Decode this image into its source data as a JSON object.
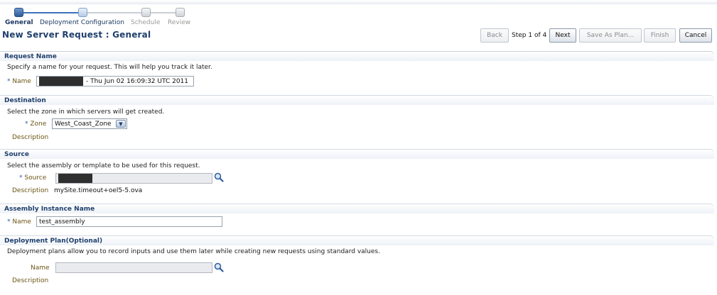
{
  "train": {
    "steps": [
      {
        "label": "General",
        "state": "active"
      },
      {
        "label": "Deployment Configuration",
        "state": "next"
      },
      {
        "label": "Schedule",
        "state": "disabled"
      },
      {
        "label": "Review",
        "state": "disabled"
      }
    ]
  },
  "page_title": "New Server Request : General",
  "toolbar": {
    "back_label": "Back",
    "step_text": "Step 1 of 4",
    "next_label": "Next",
    "save_as_plan_label": "Save As Plan...",
    "finish_label": "Finish",
    "cancel_label": "Cancel"
  },
  "request_name": {
    "header": "Request Name",
    "description": "Specify a name for your request. This will help you track it later.",
    "required_mark": "*",
    "name_label": "Name",
    "name_value": "- Thu Jun 02 16:09:32 UTC 2011"
  },
  "destination": {
    "header": "Destination",
    "description": "Select the zone in which servers will get created.",
    "required_mark": "*",
    "zone_label": "Zone",
    "zone_value": "West_Coast_Zone",
    "description_label": "Description"
  },
  "source": {
    "header": "Source",
    "description": "Select the assembly or template to be used for this request.",
    "required_mark": "*",
    "source_label": "Source",
    "description_label": "Description",
    "description_value": "mySite.timeout+oel5-5.ova"
  },
  "assembly_instance": {
    "header": "Assembly Instance Name",
    "required_mark": "*",
    "name_label": "Name",
    "name_value": "test_assembly"
  },
  "deployment_plan": {
    "header": "Deployment Plan(Optional)",
    "description": "Deployment plans allow you to record inputs and use them later while creating new requests using standard values.",
    "name_label": "Name",
    "name_value": "",
    "description_label": "Description"
  },
  "icons": {
    "search": "search-icon",
    "dropdown": "chevron-down-icon"
  },
  "colors": {
    "title": "#1f3f6c",
    "label": "#6a5414",
    "train_active": "#2d5a98"
  }
}
